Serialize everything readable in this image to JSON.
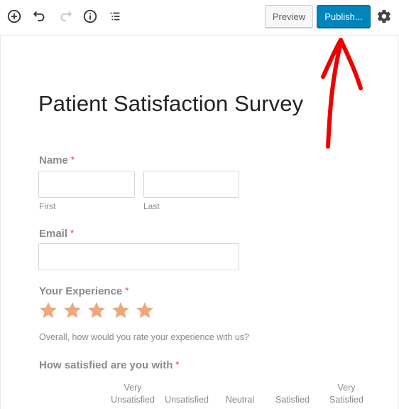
{
  "toolbar": {
    "icons": {
      "add": "plus-circle-icon",
      "undo": "undo-icon",
      "redo": "redo-icon",
      "info": "info-icon",
      "outline": "list-outline-icon",
      "settings": "gear-icon"
    },
    "preview_label": "Preview",
    "publish_label": "Publish...",
    "publish_color": "#0085ba"
  },
  "form": {
    "title": "Patient Satisfaction Survey",
    "required_marker": "*",
    "required_color": "#d63638",
    "name": {
      "label": "Name",
      "first_value": "",
      "last_value": "",
      "first_sublabel": "First",
      "last_sublabel": "Last"
    },
    "email": {
      "label": "Email",
      "value": ""
    },
    "experience": {
      "label": "Your Experience",
      "star_count": 5,
      "star_color": "#eba97e",
      "description": "Overall, how would you rate your experience with us?"
    },
    "satisfaction": {
      "label": "How satisfied are you with",
      "columns": [
        {
          "line1": "Very",
          "line2": "Unsatisfied"
        },
        {
          "line1": "",
          "line2": "Unsatisfied"
        },
        {
          "line1": "",
          "line2": "Neutral"
        },
        {
          "line1": "",
          "line2": "Satisfied"
        },
        {
          "line1": "Very",
          "line2": "Satisfied"
        }
      ]
    }
  },
  "annotation": {
    "arrow_color": "#ee0000",
    "points_to": "publish-button"
  }
}
